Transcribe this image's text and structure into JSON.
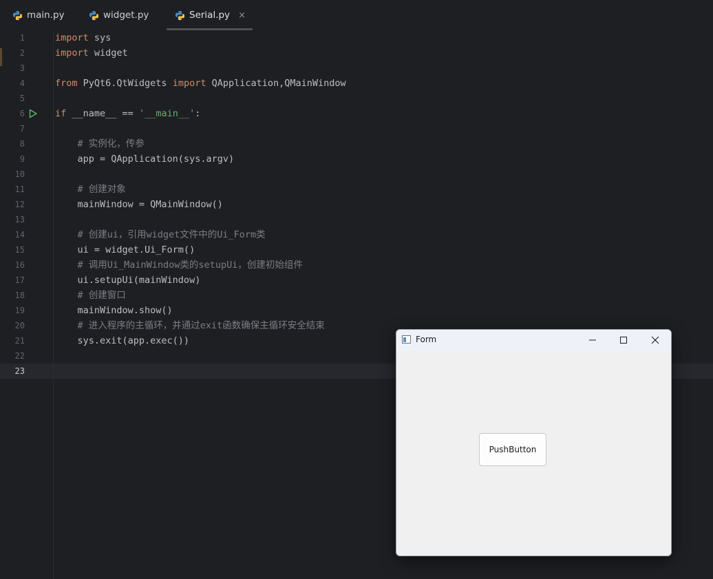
{
  "tabs": [
    {
      "label": "main.py",
      "active": false
    },
    {
      "label": "widget.py",
      "active": false
    },
    {
      "label": "Serial.py",
      "active": true,
      "close": "×"
    }
  ],
  "editor": {
    "current_line": 23,
    "line_numbers": [
      "1",
      "2",
      "3",
      "4",
      "5",
      "6",
      "7",
      "8",
      "9",
      "10",
      "11",
      "12",
      "13",
      "14",
      "15",
      "16",
      "17",
      "18",
      "19",
      "20",
      "21",
      "22",
      "23"
    ],
    "lines": [
      "import sys",
      "import widget",
      "",
      "from PyQt6.QtWidgets import QApplication,QMainWindow",
      "",
      "if __name__ == '__main__':",
      "",
      "    # 实例化，传参",
      "    app = QApplication(sys.argv)",
      "",
      "    # 创建对象",
      "    mainWindow = QMainWindow()",
      "",
      "    # 创建ui，引用widget文件中的Ui_Form类",
      "    ui = widget.Ui_Form()",
      "    # 调用Ui_MainWindow类的setupUi，创建初始组件",
      "    ui.setupUi(mainWindow)",
      "    # 创建窗口",
      "    mainWindow.show()",
      "    # 进入程序的主循环，并通过exit函数确保主循环安全结束",
      "    sys.exit(app.exec())",
      "",
      ""
    ],
    "icons": {
      "run_gutter": "run-triangle-icon",
      "file_type": "python-icon"
    }
  },
  "qt_window": {
    "title": "Form",
    "button_label": "PushButton",
    "icons": {
      "app": "window-app-icon",
      "minimize": "minimize-icon",
      "maximize": "maximize-icon",
      "close": "close-icon"
    }
  },
  "colors": {
    "editor_bg": "#1e1f22",
    "keyword": "#cf8e6d",
    "string": "#6aab73",
    "comment": "#7a7e85",
    "text": "#bcbec4",
    "qt_bg": "#f0f0f0"
  }
}
